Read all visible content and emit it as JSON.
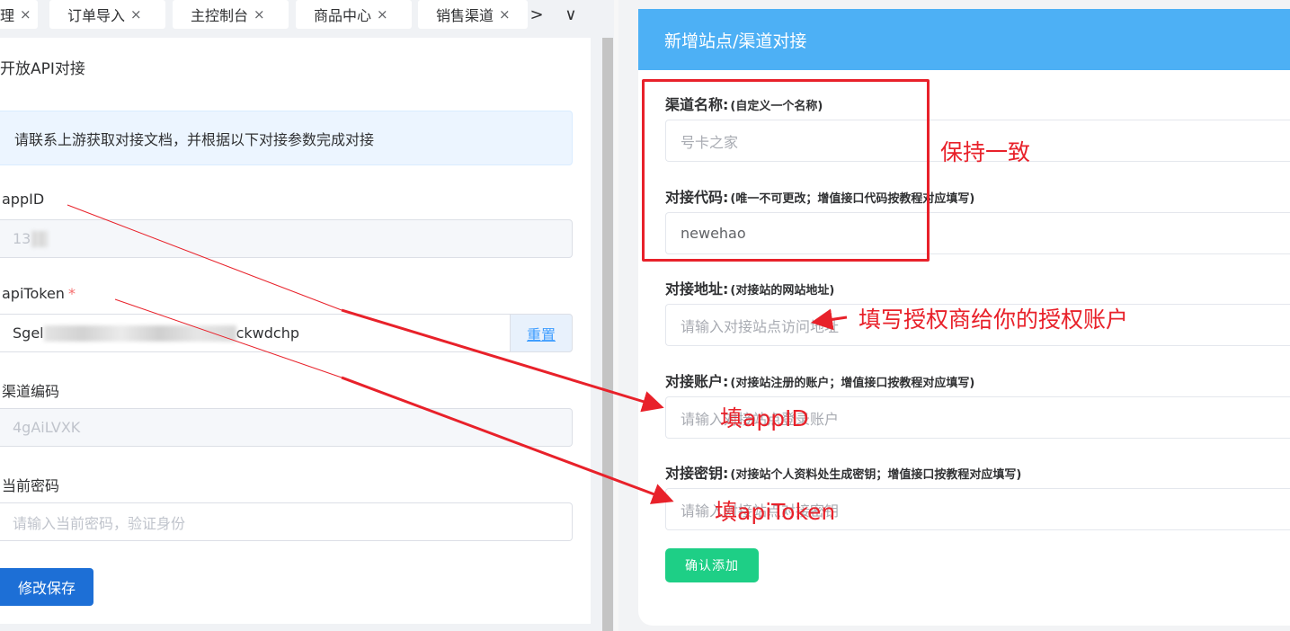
{
  "tabs": {
    "items": [
      {
        "label": "理"
      },
      {
        "label": "订单导入"
      },
      {
        "label": "主控制台"
      },
      {
        "label": "商品中心"
      },
      {
        "label": "销售渠道"
      }
    ],
    "close_glyph": "×",
    "next_glyph": ">",
    "menu_glyph": "∨"
  },
  "left_form": {
    "title": "开放API对接",
    "alert": "请联系上游获取对接文档，并根据以下对接参数完成对接",
    "appid_label": "appID",
    "appid_value": "13",
    "apitoken_label": "apiToken",
    "apitoken_required": "*",
    "apitoken_prefix": "Sgel",
    "apitoken_suffix": "ckwdchp",
    "reset_button": "重置",
    "channel_code_label": "渠道编码",
    "channel_code_value": "4gAiLVXK",
    "password_label": "当前密码",
    "password_placeholder": "请输入当前密码，验证身份",
    "save_button": "修改保存"
  },
  "right_form": {
    "header": "新增站点/渠道对接",
    "channel_name_label": "渠道名称:",
    "channel_name_hint": "(自定义一个名称)",
    "channel_name_placeholder": "号卡之家",
    "code_label": "对接代码:",
    "code_hint": "(唯一不可更改；增值接口代码按教程对应填写)",
    "code_value": "newehao",
    "address_label": "对接地址:",
    "address_hint": "(对接站的网站地址)",
    "address_placeholder": "请输入对接站点访问地址",
    "account_label": "对接账户:",
    "account_hint": "(对接站注册的账户；增值接口按教程对应填写)",
    "account_placeholder": "请输入对接站点登录账户",
    "secret_label": "对接密钥:",
    "secret_hint": "(对接站个人资料处生成密钥；增值接口按教程对应填写)",
    "secret_placeholder": "请输入对接站点对接密钥",
    "add_button": "确认添加"
  },
  "annotations": {
    "keep_consistent": "保持一致",
    "fill_auth_account": "填写授权商给你的授权账户",
    "fill_appid": "填appID",
    "fill_apitoken": "填apiToken",
    "color": "#e8212a"
  }
}
